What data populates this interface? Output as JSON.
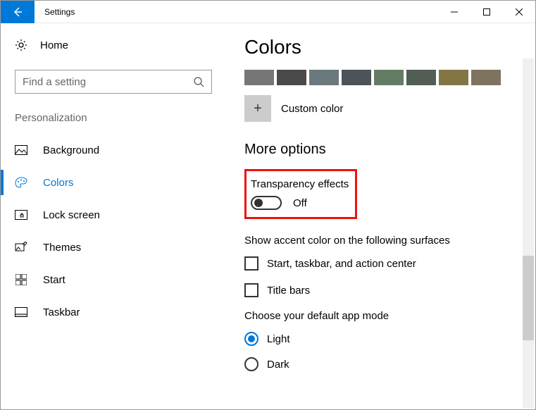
{
  "window": {
    "title": "Settings"
  },
  "sidebar": {
    "home": "Home",
    "search_placeholder": "Find a setting",
    "section": "Personalization",
    "items": [
      {
        "label": "Background"
      },
      {
        "label": "Colors"
      },
      {
        "label": "Lock screen"
      },
      {
        "label": "Themes"
      },
      {
        "label": "Start"
      },
      {
        "label": "Taskbar"
      }
    ]
  },
  "main": {
    "title": "Colors",
    "swatches": [
      "#767676",
      "#4c4a48",
      "#69797e",
      "#4a5459",
      "#647c64",
      "#525e54",
      "#847545",
      "#7e735f"
    ],
    "custom_color": "Custom color",
    "more_options": "More options",
    "transparency": {
      "label": "Transparency effects",
      "state": "Off"
    },
    "surface_label": "Show accent color on the following surfaces",
    "checks": [
      "Start, taskbar, and action center",
      "Title bars"
    ],
    "mode_label": "Choose your default app mode",
    "modes": [
      "Light",
      "Dark"
    ]
  }
}
